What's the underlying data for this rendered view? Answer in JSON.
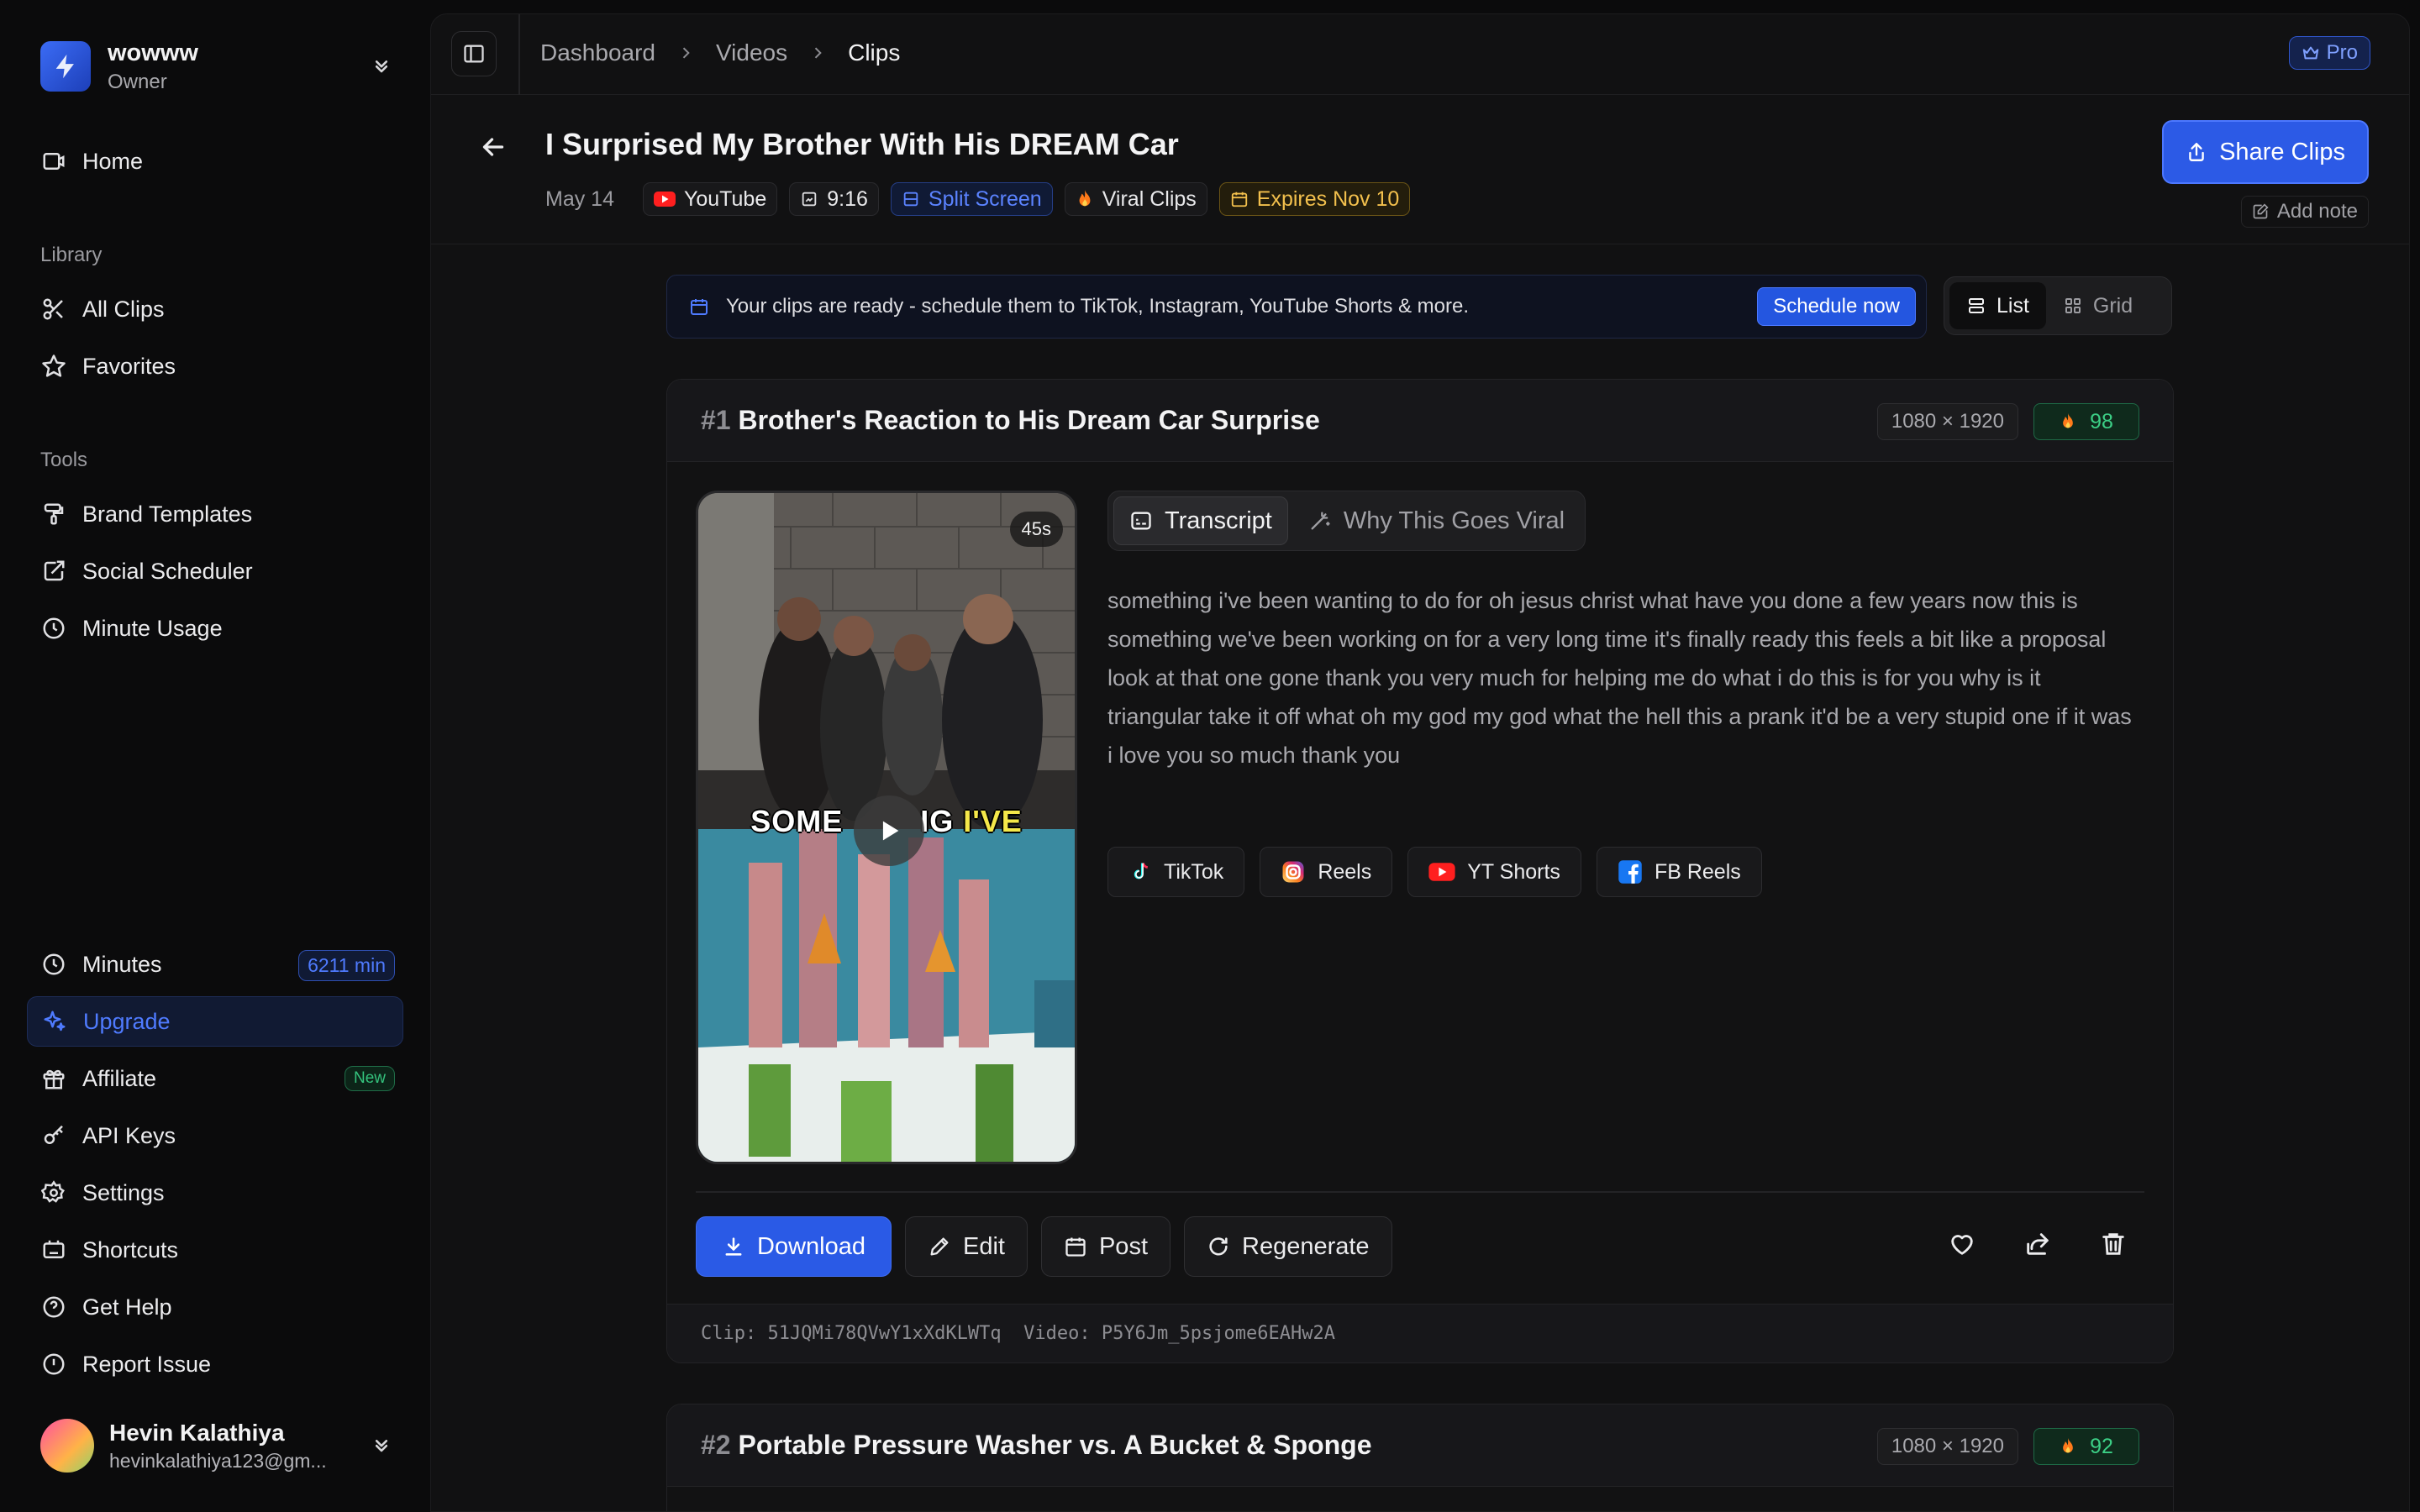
{
  "workspace": {
    "name": "wowww",
    "role": "Owner"
  },
  "sidebar": {
    "home": "Home",
    "library_label": "Library",
    "library": [
      "All Clips",
      "Favorites"
    ],
    "tools_label": "Tools",
    "tools": [
      "Brand Templates",
      "Social Scheduler",
      "Minute Usage"
    ],
    "minutes_label": "Minutes",
    "minutes_value": "6211 min",
    "upgrade": "Upgrade",
    "affiliate": "Affiliate",
    "affiliate_badge": "New",
    "api_keys": "API Keys",
    "settings": "Settings",
    "shortcuts": "Shortcuts",
    "get_help": "Get Help",
    "report_issue": "Report Issue"
  },
  "user": {
    "name": "Hevin Kalathiya",
    "email": "hevinkalathiya123@gm..."
  },
  "breadcrumb": [
    "Dashboard",
    "Videos",
    "Clips"
  ],
  "plan_badge": "Pro",
  "video": {
    "title": "I Surprised My Brother With His DREAM Car",
    "date": "May 14",
    "source": "YouTube",
    "aspect": "9:16",
    "layout": "Split Screen",
    "category": "Viral Clips",
    "expires": "Expires Nov 10"
  },
  "share_button": "Share Clips",
  "add_note": "Add note",
  "banner": {
    "text": "Your clips are ready - schedule them to TikTok, Instagram, YouTube Shorts & more.",
    "cta": "Schedule now"
  },
  "view_toggle": {
    "list": "List",
    "grid": "Grid",
    "selected": "List"
  },
  "clips": [
    {
      "rank": "#1",
      "title": "Brother's Reaction to His Dream Car Surprise",
      "resolution": "1080 × 1920",
      "score": "98",
      "duration": "45s",
      "caption_white": "SOME",
      "caption_mid": "IG ",
      "caption_yellow": "I'VE",
      "tabs": {
        "transcript": "Transcript",
        "viral": "Why This Goes Viral",
        "selected": "Transcript"
      },
      "transcript": "something i've been wanting to do for oh jesus christ what have you done a few years now this is something we've been working on for a very long time it's finally ready this feels a bit like a proposal look at that one gone thank you very much for helping me do what i do this is for you why is it triangular take it off what oh my god my god what the hell this a prank it'd be a very stupid one if it was i love you so much thank you",
      "platforms": [
        "TikTok",
        "Reels",
        "YT Shorts",
        "FB Reels"
      ],
      "actions": {
        "download": "Download",
        "edit": "Edit",
        "post": "Post",
        "regenerate": "Regenerate"
      },
      "footer": "Clip: 51JQMi78QVwY1xXdKLWTq  Video: P5Y6Jm_5psjome6EAHw2A"
    },
    {
      "rank": "#2",
      "title": "Portable Pressure Washer vs. A Bucket & Sponge",
      "resolution": "1080 × 1920",
      "score": "92"
    }
  ],
  "colors": {
    "accent": "#2a5ae6",
    "score_green": "#3ccf86",
    "amber": "#f3c04d",
    "bg": "#0b0b0c"
  }
}
